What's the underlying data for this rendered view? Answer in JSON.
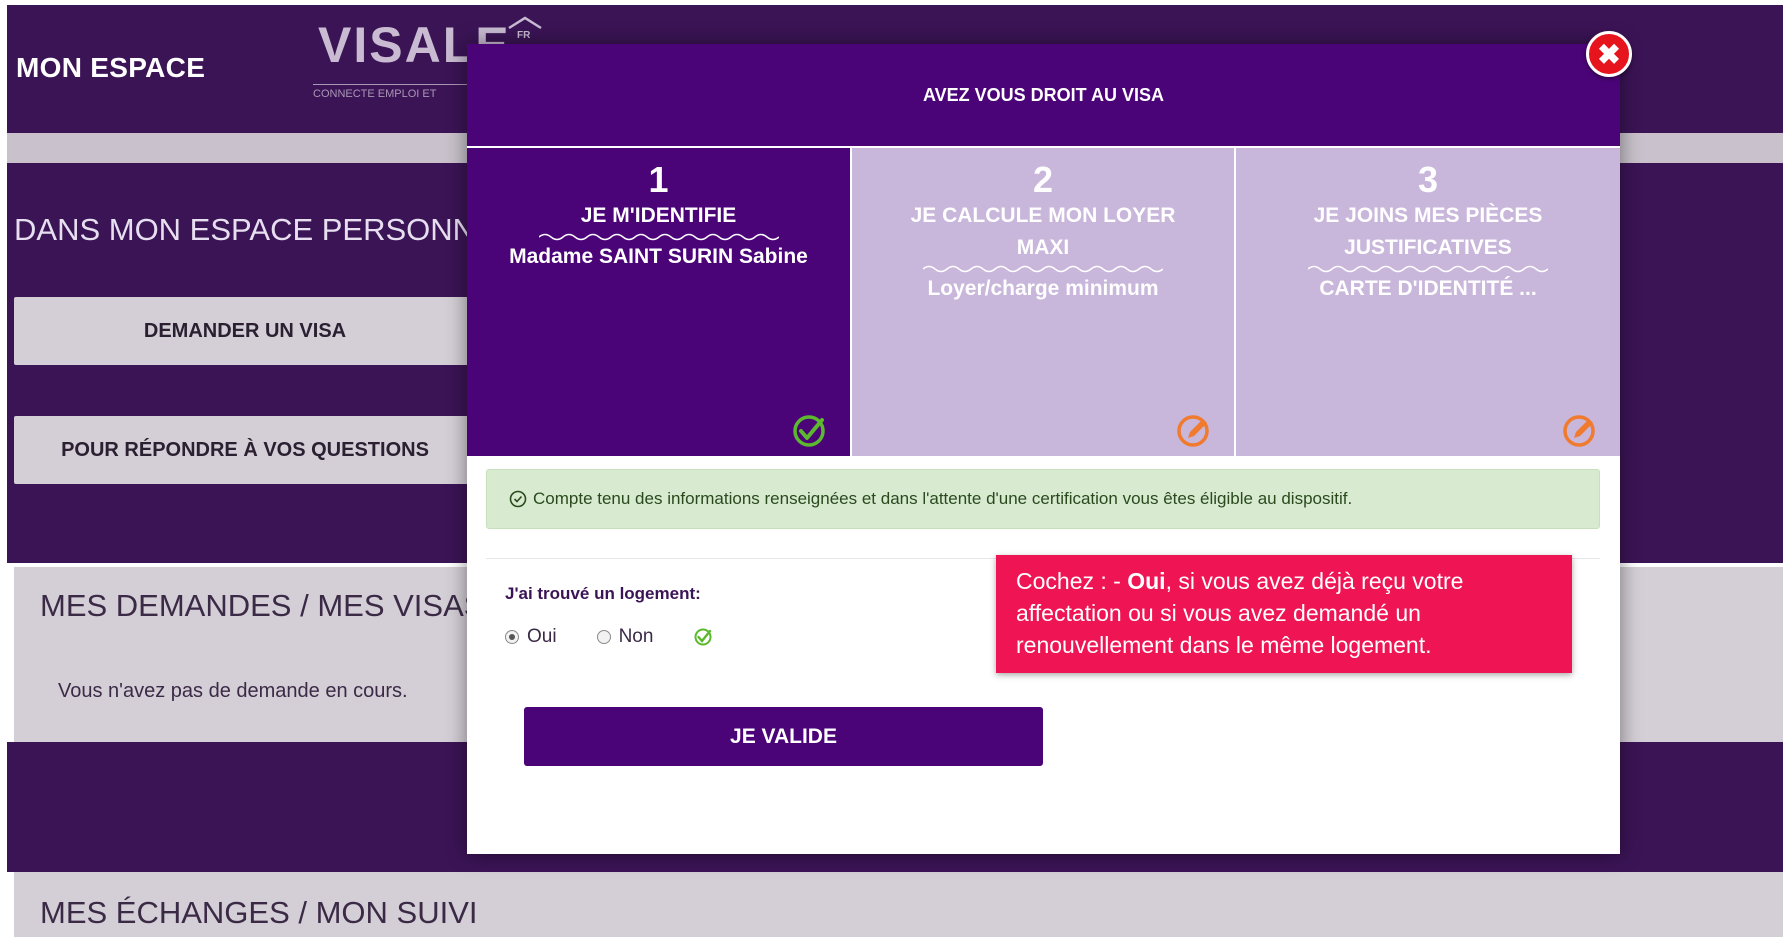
{
  "header": {
    "space_title": "MON ESPACE",
    "logo_word": "VISALE",
    "logo_badge": "FR",
    "logo_subtitle": "CONNECTE EMPLOI ET"
  },
  "sidebar": {
    "personal_title": "DANS MON ESPACE PERSONNEL",
    "request_visa_label": "DEMANDER UN VISA",
    "questions_label": "POUR RÉPONDRE À VOS QUESTIONS"
  },
  "requests": {
    "title": "MES DEMANDES / MES VISAS",
    "empty_text": "Vous n'avez pas de demande en cours."
  },
  "exchanges": {
    "title": "MES ÉCHANGES / MON SUIVI"
  },
  "modal": {
    "title": "AVEZ VOUS DROIT AU VISA",
    "steps": [
      {
        "number": "1",
        "title": "JE M'IDENTIFIE",
        "value": "Madame SAINT SURIN Sabine",
        "status": "done",
        "status_icon": "check-circle-icon"
      },
      {
        "number": "2",
        "title": "JE CALCULE MON LOYER MAXI",
        "value": "Loyer/charge minimum",
        "status": "edit",
        "status_icon": "edit-pencil-icon"
      },
      {
        "number": "3",
        "title": "JE JOINS MES PIÈCES JUSTIFICATIVES",
        "value": "CARTE D'IDENTITÉ ...",
        "status": "edit",
        "status_icon": "edit-pencil-icon"
      }
    ],
    "alert_text": "Compte tenu des informations renseignées et dans l'attente d'une certification vous êtes éligible au dispositif.",
    "housing_label": "J'ai trouvé un logement:",
    "housing_options": [
      {
        "label": "Oui",
        "selected": true
      },
      {
        "label": "Non",
        "selected": false
      }
    ],
    "validate_label": "JE VALIDE",
    "close_symbol": "✖"
  },
  "tooltip": {
    "prefix": "Cochez : - ",
    "highlight": "Oui",
    "text": ", si vous avez déjà reçu votre affectation ou si vous avez demandé un renouvellement dans le même logement."
  },
  "colors": {
    "brand_purple": "#4b0478",
    "page_dark": "#3b1456",
    "step_todo": "#c9b6db",
    "success_green": "#5cb82e",
    "edit_orange": "#f07a2e",
    "tooltip_pink": "#ef1453",
    "close_red": "#e5141d"
  }
}
